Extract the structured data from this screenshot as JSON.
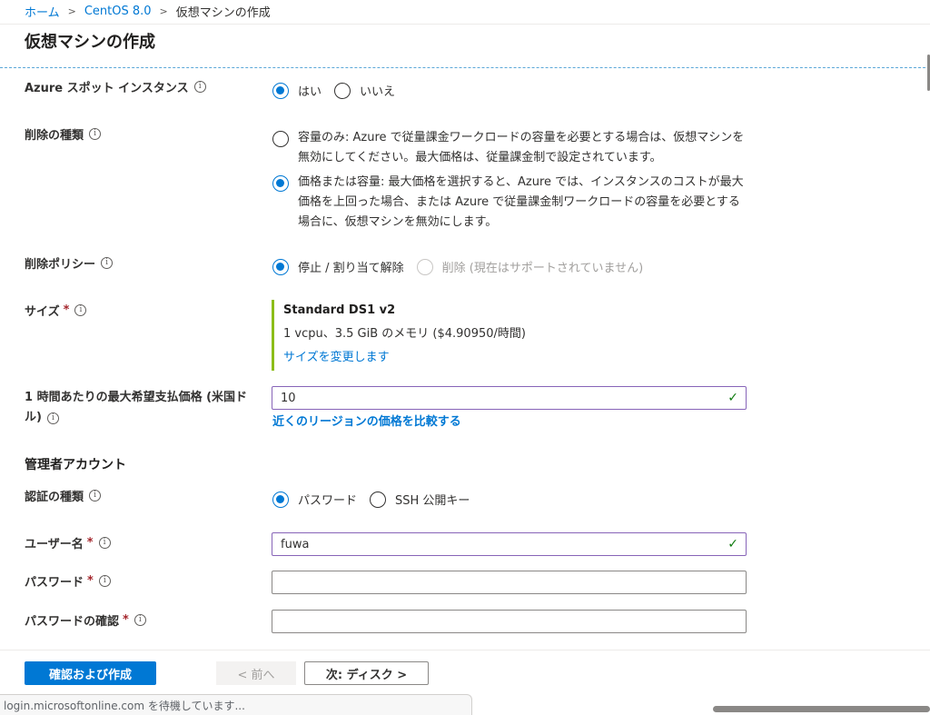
{
  "breadcrumb": {
    "items": [
      {
        "label": "ホーム"
      },
      {
        "label": "CentOS 8.0"
      }
    ],
    "separator": ">",
    "current": "仮想マシンの作成"
  },
  "page": {
    "title": "仮想マシンの作成"
  },
  "info_glyph": "i",
  "required_mark": "*",
  "spot": {
    "label": "Azure スポット インスタンス",
    "options": [
      {
        "label": "はい",
        "checked": true
      },
      {
        "label": "いいえ",
        "checked": false
      }
    ]
  },
  "eviction_type": {
    "label": "削除の種類",
    "options": [
      {
        "label": "容量のみ: Azure で従量課金ワークロードの容量を必要とする場合は、仮想マシンを無効にしてください。最大価格は、従量課金制で設定されています。",
        "checked": false
      },
      {
        "label": "価格または容量: 最大価格を選択すると、Azure では、インスタンスのコストが最大価格を上回った場合、または Azure で従量課金制ワークロードの容量を必要とする場合に、仮想マシンを無効にします。",
        "checked": true
      }
    ]
  },
  "eviction_policy": {
    "label": "削除ポリシー",
    "options": [
      {
        "label": "停止 / 割り当て解除",
        "checked": true,
        "disabled": false
      },
      {
        "label": "削除 (現在はサポートされていません)",
        "checked": false,
        "disabled": true
      }
    ]
  },
  "size": {
    "label": "サイズ",
    "name": "Standard DS1 v2",
    "spec": "1 vcpu、3.5 GiB のメモリ ($4.90950/時間)",
    "change_link": "サイズを変更します"
  },
  "max_price": {
    "label_line1": "1 時間あたりの最大希望支払価格 (米国ド",
    "label_line2": "ル)",
    "value": "10",
    "compare_link": "近くのリージョンの価格を比較する"
  },
  "admin": {
    "section_title": "管理者アカウント",
    "auth_type": {
      "label": "認証の種類",
      "options": [
        {
          "label": "パスワード",
          "checked": true
        },
        {
          "label": "SSH 公開キー",
          "checked": false
        }
      ]
    },
    "username": {
      "label": "ユーザー名",
      "value": "fuwa"
    },
    "password": {
      "label": "パスワード",
      "value": ""
    },
    "password_confirm": {
      "label": "パスワードの確認",
      "value": ""
    }
  },
  "footer": {
    "review_button": "確認および作成",
    "prev_button": "< 前へ",
    "next_button": "次: ディスク >"
  },
  "status_bar": {
    "text": "login.microsoftonline.com を待機しています..."
  },
  "colors": {
    "accent": "#0078d4",
    "valid_border": "#8764b8",
    "size_bar": "#8cbd18",
    "required": "#a4262c"
  }
}
